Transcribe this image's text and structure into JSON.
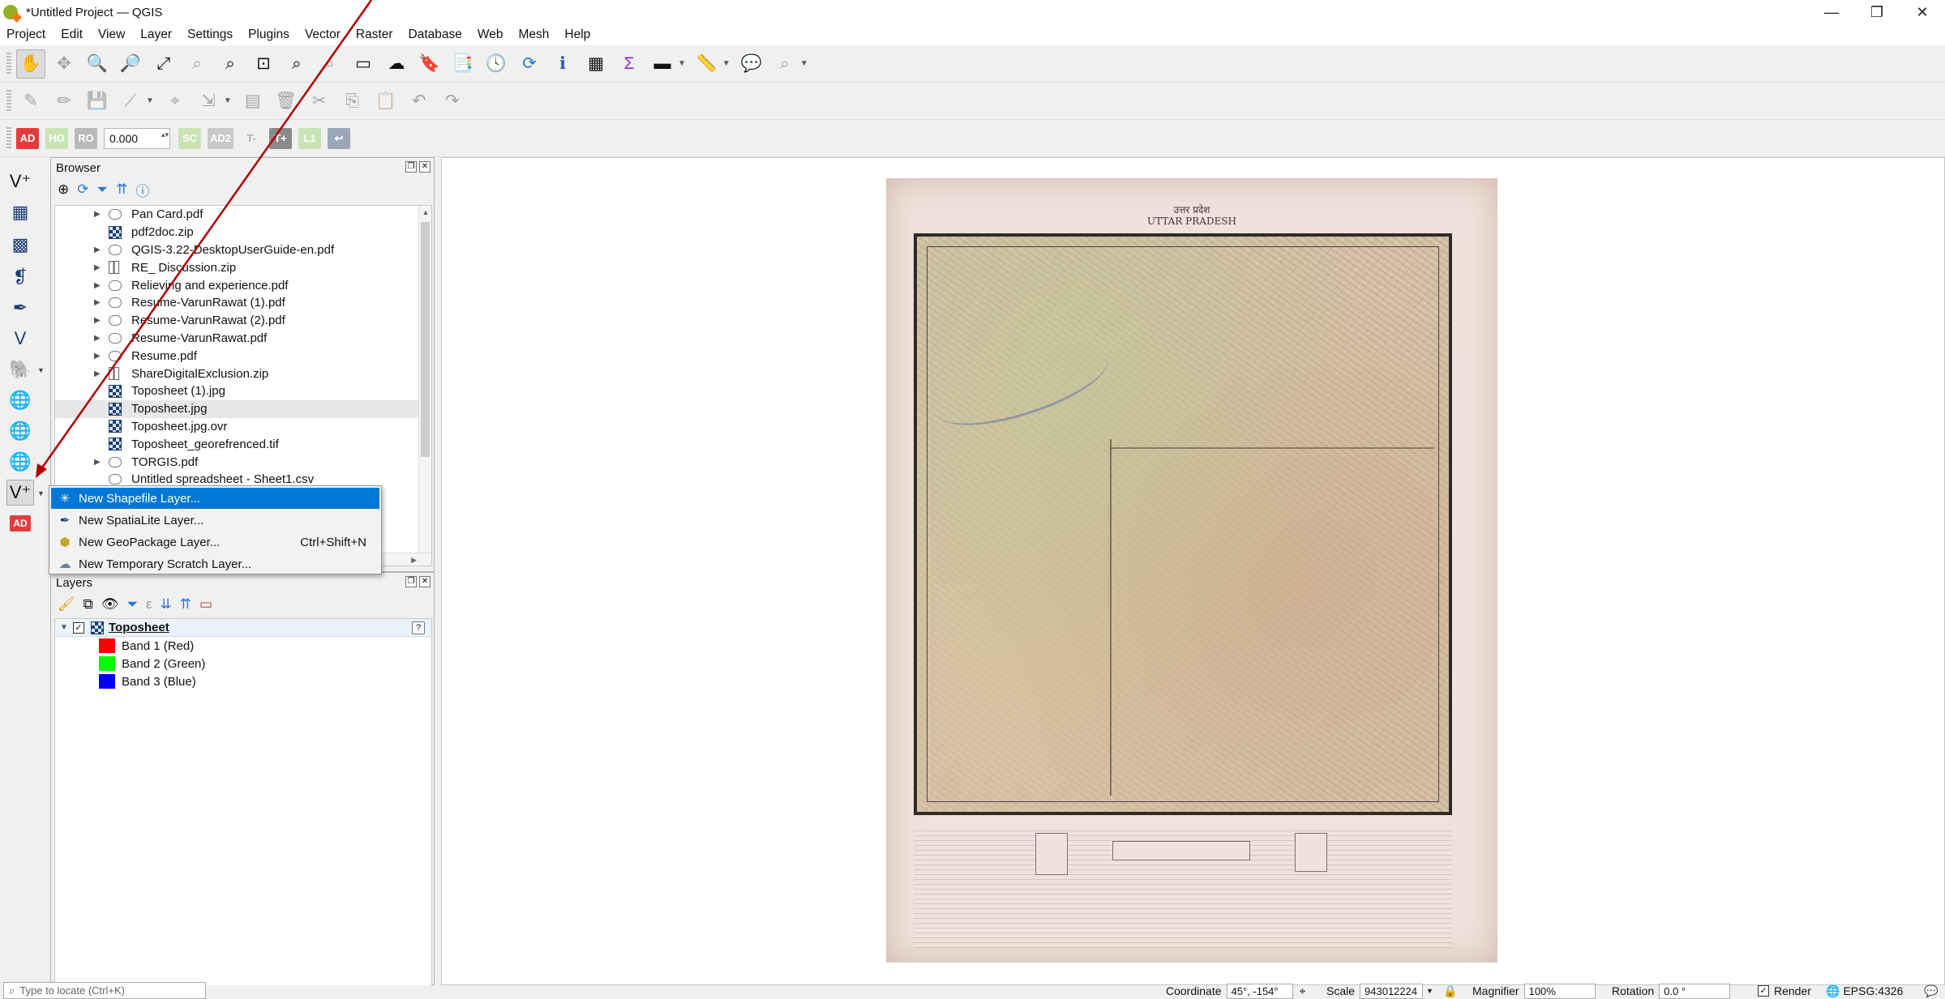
{
  "window": {
    "title": "*Untitled Project — QGIS",
    "controls": [
      "—",
      "❐",
      "✕"
    ]
  },
  "menubar": [
    "Project",
    "Edit",
    "View",
    "Layer",
    "Settings",
    "Plugins",
    "Vector",
    "Raster",
    "Database",
    "Web",
    "Mesh",
    "Help"
  ],
  "toolbar_advanced_digitizing": {
    "tags": [
      "AD",
      "HO",
      "RO",
      "SC",
      "AD2",
      "T-",
      "T+",
      "L1"
    ],
    "distance_value": "0.000"
  },
  "browser": {
    "title": "Browser",
    "items": [
      {
        "label": "Pan Card.pdf",
        "type": "pdf",
        "expandable": true
      },
      {
        "label": "pdf2doc.zip",
        "type": "raster",
        "expandable": false
      },
      {
        "label": "QGIS-3.22-DesktopUserGuide-en.pdf",
        "type": "pdf",
        "expandable": true
      },
      {
        "label": "RE_ Discussion.zip",
        "type": "zip",
        "expandable": true
      },
      {
        "label": "Relieving and experience.pdf",
        "type": "pdf",
        "expandable": true
      },
      {
        "label": "Resume-VarunRawat (1).pdf",
        "type": "pdf",
        "expandable": true
      },
      {
        "label": "Resume-VarunRawat (2).pdf",
        "type": "pdf",
        "expandable": true
      },
      {
        "label": "Resume-VarunRawat.pdf",
        "type": "pdf",
        "expandable": true
      },
      {
        "label": "Resume.pdf",
        "type": "pdf",
        "expandable": true
      },
      {
        "label": "ShareDigitalExclusion.zip",
        "type": "zip",
        "expandable": true
      },
      {
        "label": "Toposheet (1).jpg",
        "type": "raster",
        "expandable": false
      },
      {
        "label": "Toposheet.jpg",
        "type": "raster",
        "expandable": false,
        "selected": true
      },
      {
        "label": "Toposheet.jpg.ovr",
        "type": "raster",
        "expandable": false
      },
      {
        "label": "Toposheet_georefrenced.tif",
        "type": "raster",
        "expandable": false
      },
      {
        "label": "TORGIS.pdf",
        "type": "pdf",
        "expandable": true
      },
      {
        "label": "Untitled spreadsheet - Sheet1.csv",
        "type": "pdf",
        "expandable": false
      }
    ]
  },
  "context_menu": {
    "items": [
      {
        "label": "New Shapefile Layer...",
        "shortcut": "",
        "highlighted": true
      },
      {
        "label": "New SpatiaLite Layer...",
        "shortcut": ""
      },
      {
        "label": "New GeoPackage Layer...",
        "shortcut": "Ctrl+Shift+N"
      },
      {
        "label": "New Temporary Scratch Layer...",
        "shortcut": ""
      }
    ]
  },
  "layers": {
    "title": "Layers",
    "layer_name": "Toposheet",
    "bands": [
      {
        "label": "Band 1 (Red)",
        "color": "#ff0000"
      },
      {
        "label": "Band 2 (Green)",
        "color": "#00ff00"
      },
      {
        "label": "Band 3 (Blue)",
        "color": "#0000ff"
      }
    ]
  },
  "map": {
    "header_hindi": "उत्तर प्रदेश",
    "header_english": "UTTAR PRADESH"
  },
  "statusbar": {
    "locator_placeholder": "Type to locate (Ctrl+K)",
    "coordinate_label": "Coordinate",
    "coordinate_value": "45°, -154°",
    "scale_label": "Scale",
    "scale_value": "943012224",
    "magnifier_label": "Magnifier",
    "magnifier_value": "100%",
    "rotation_label": "Rotation",
    "rotation_value": "0.0 °",
    "render_label": "Render",
    "crs": "EPSG:4326"
  },
  "colors": {
    "highlight": "#0078d7",
    "annotation_arrow": "#b00000"
  }
}
